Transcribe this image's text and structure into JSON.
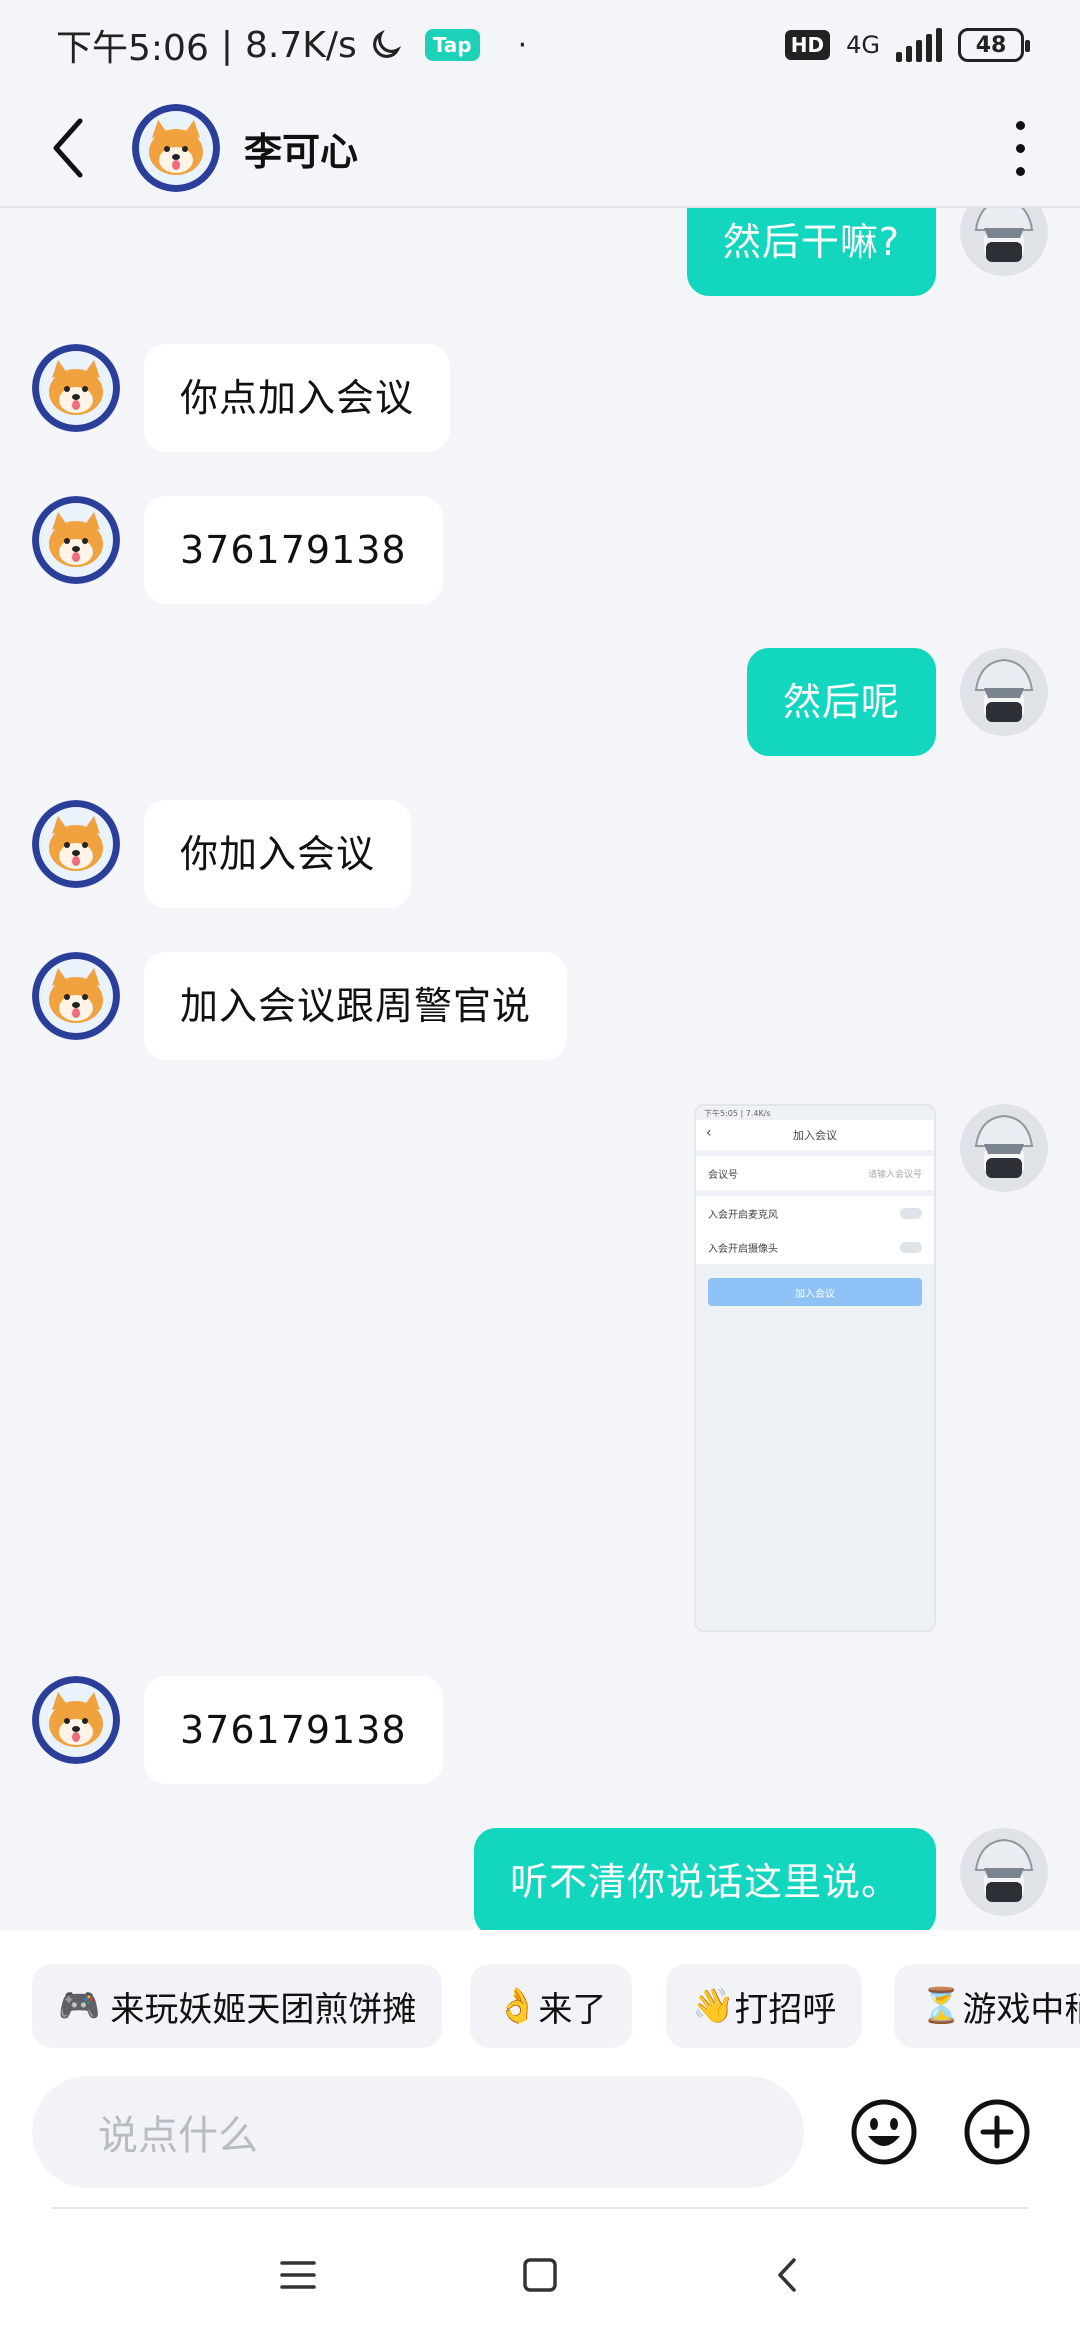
{
  "status_bar": {
    "time": "下午5:06",
    "network_speed": "8.7K/s",
    "tap_badge": "Tap",
    "dot": "·",
    "hd": "HD",
    "network": "4G",
    "battery": "48",
    "moon_icon": "moon-icon"
  },
  "header": {
    "contact_name": "李可心",
    "back_icon": "chevron-left-icon",
    "more_icon": "more-vertical-icon"
  },
  "messages": [
    {
      "side": "right",
      "text": "然后干嘛?"
    },
    {
      "side": "left",
      "text": "你点加入会议"
    },
    {
      "side": "left",
      "text": "376179138"
    },
    {
      "side": "right",
      "text": "然后呢"
    },
    {
      "side": "left",
      "text": "你加入会议"
    },
    {
      "side": "left",
      "text": "加入会议跟周警官说"
    },
    {
      "side": "right",
      "type": "image"
    },
    {
      "side": "left",
      "text": "376179138"
    },
    {
      "side": "right",
      "text": "听不清你说话这里说。"
    }
  ],
  "screenshot_thumb": {
    "status": "下午5:05 | 7.4K/s",
    "title": "加入会议",
    "meeting_id_label": "会议号",
    "meeting_id_placeholder": "请输入会议号",
    "mic_label": "入会开启麦克风",
    "camera_label": "入会开启摄像头",
    "join_button": "加入会议"
  },
  "quick_replies": [
    {
      "emoji": "🎮",
      "label": "来玩妖姬天团煎饼摊"
    },
    {
      "emoji": "👌",
      "label": "来了"
    },
    {
      "emoji": "👋",
      "label": "打招呼"
    },
    {
      "emoji": "⏳",
      "label": "游戏中稍"
    }
  ],
  "input": {
    "placeholder": "说点什么",
    "emoji_icon": "emoji-icon",
    "add_icon": "plus-circle-icon"
  },
  "nav": {
    "menu_icon": "menu-icon",
    "home_icon": "home-icon",
    "back_icon": "back-icon"
  },
  "colors": {
    "accent": "#13d6be",
    "background": "#f3f5f8",
    "bubble_left": "#ffffff"
  }
}
